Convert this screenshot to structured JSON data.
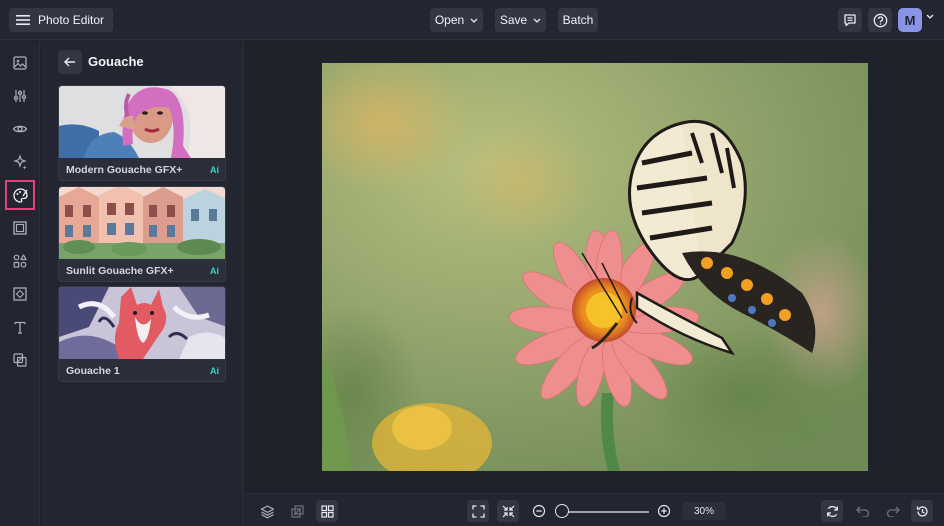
{
  "app": {
    "title": "Photo Editor"
  },
  "toolbar": {
    "open_label": "Open",
    "save_label": "Save",
    "batch_label": "Batch"
  },
  "user": {
    "avatar_initial": "M"
  },
  "sidebar": {
    "items": [
      {
        "name": "image-icon"
      },
      {
        "name": "adjustments-icon"
      },
      {
        "name": "eye-icon"
      },
      {
        "name": "magic-sparkle-icon"
      },
      {
        "name": "artsy-palette-icon",
        "active": true
      },
      {
        "name": "frame-icon"
      },
      {
        "name": "graphics-icon"
      },
      {
        "name": "texture-icon"
      },
      {
        "name": "text-icon"
      },
      {
        "name": "overlay-icon"
      }
    ]
  },
  "panel": {
    "title": "Gouache",
    "effects": [
      {
        "label": "Modern Gouache GFX+",
        "badge": "Ai"
      },
      {
        "label": "Sunlit Gouache GFX+",
        "badge": "Ai"
      },
      {
        "label": "Gouache 1",
        "badge": "Ai"
      }
    ]
  },
  "zoom": {
    "value": "30%"
  },
  "colors": {
    "accent_active": "#e7407a",
    "ai_badge": "#3ad3c4",
    "avatar_bg": "#8a94e6"
  }
}
